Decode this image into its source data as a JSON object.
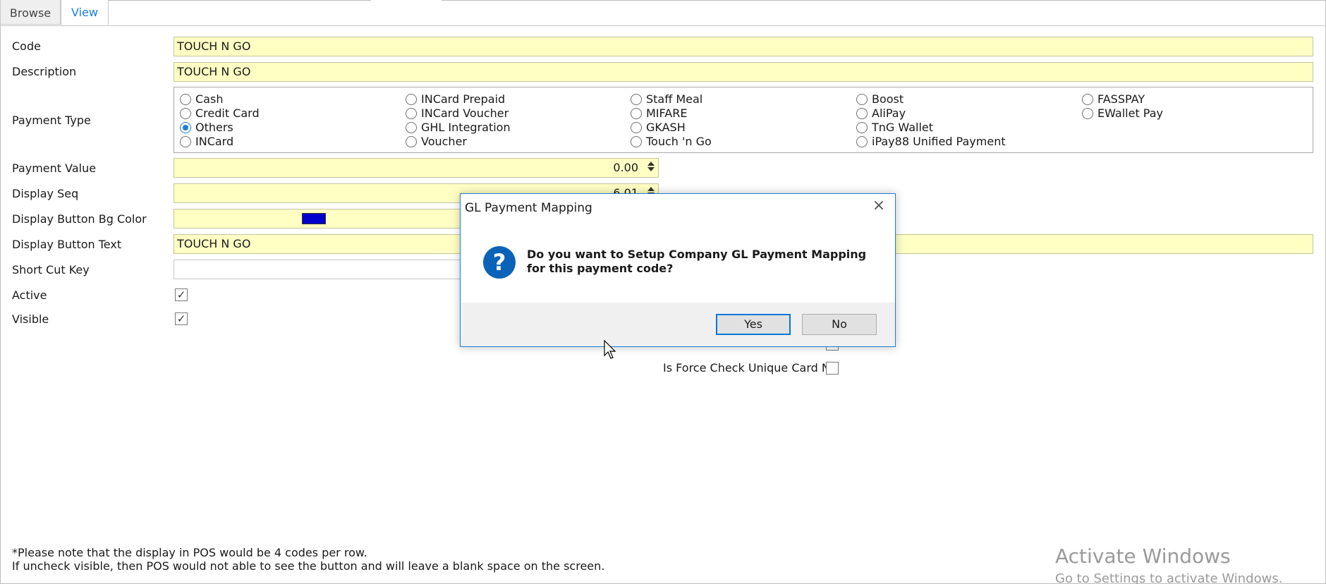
{
  "tabs": [
    {
      "label": "Browse"
    },
    {
      "label": "View"
    }
  ],
  "form": {
    "code": {
      "label": "Code",
      "value": "TOUCH N GO"
    },
    "description": {
      "label": "Description",
      "value": "TOUCH N GO"
    },
    "payment_type": {
      "label": "Payment Type",
      "options": [
        "Cash",
        "Credit Card",
        "Others",
        "INCard",
        "INCard Prepaid",
        "INCard Voucher",
        "GHL Integration",
        "Voucher",
        "Staff Meal",
        "MIFARE",
        "GKASH",
        "Touch 'n Go",
        "Boost",
        "AliPay",
        "TnG Wallet",
        "iPay88 Unified Payment",
        "FASSPAY",
        "EWallet Pay"
      ],
      "selected": "Others"
    },
    "payment_value": {
      "label": "Payment Value",
      "value": "0.00"
    },
    "display_seq": {
      "label": "Display Seq",
      "value": "6.01"
    },
    "display_button_bg_color": {
      "label": "Display Button Bg Color",
      "color": "#0000cc"
    },
    "display_button_text": {
      "label": "Display Button Text",
      "value": "TOUCH N GO"
    },
    "short_cut_key": {
      "label": "Short Cut Key",
      "value": ""
    },
    "active": {
      "label": "Active",
      "checked": true
    },
    "visible": {
      "label": "Visible",
      "checked": true
    },
    "is_force_check_unique_card_no": {
      "label": "Is Force Check Unique Card No",
      "checked": false
    }
  },
  "notes": {
    "line1": "*Please note that the display in POS would be 4 codes per row.",
    "line2": "If uncheck visible, then POS would not able to see the button and will leave a blank space on the screen."
  },
  "watermark": {
    "line1": "Activate Windows",
    "line2": "Go to Settings to activate Windows."
  },
  "dialog": {
    "title": "GL Payment Mapping",
    "message": "Do you want to Setup Company GL Payment Mapping for this payment code?",
    "yes": "Yes",
    "no": "No",
    "icon": "question-icon"
  },
  "colors": {
    "field_bg": "#ffffc4",
    "accent": "#1a7fd6",
    "dialog_icon": "#0a63b8"
  }
}
